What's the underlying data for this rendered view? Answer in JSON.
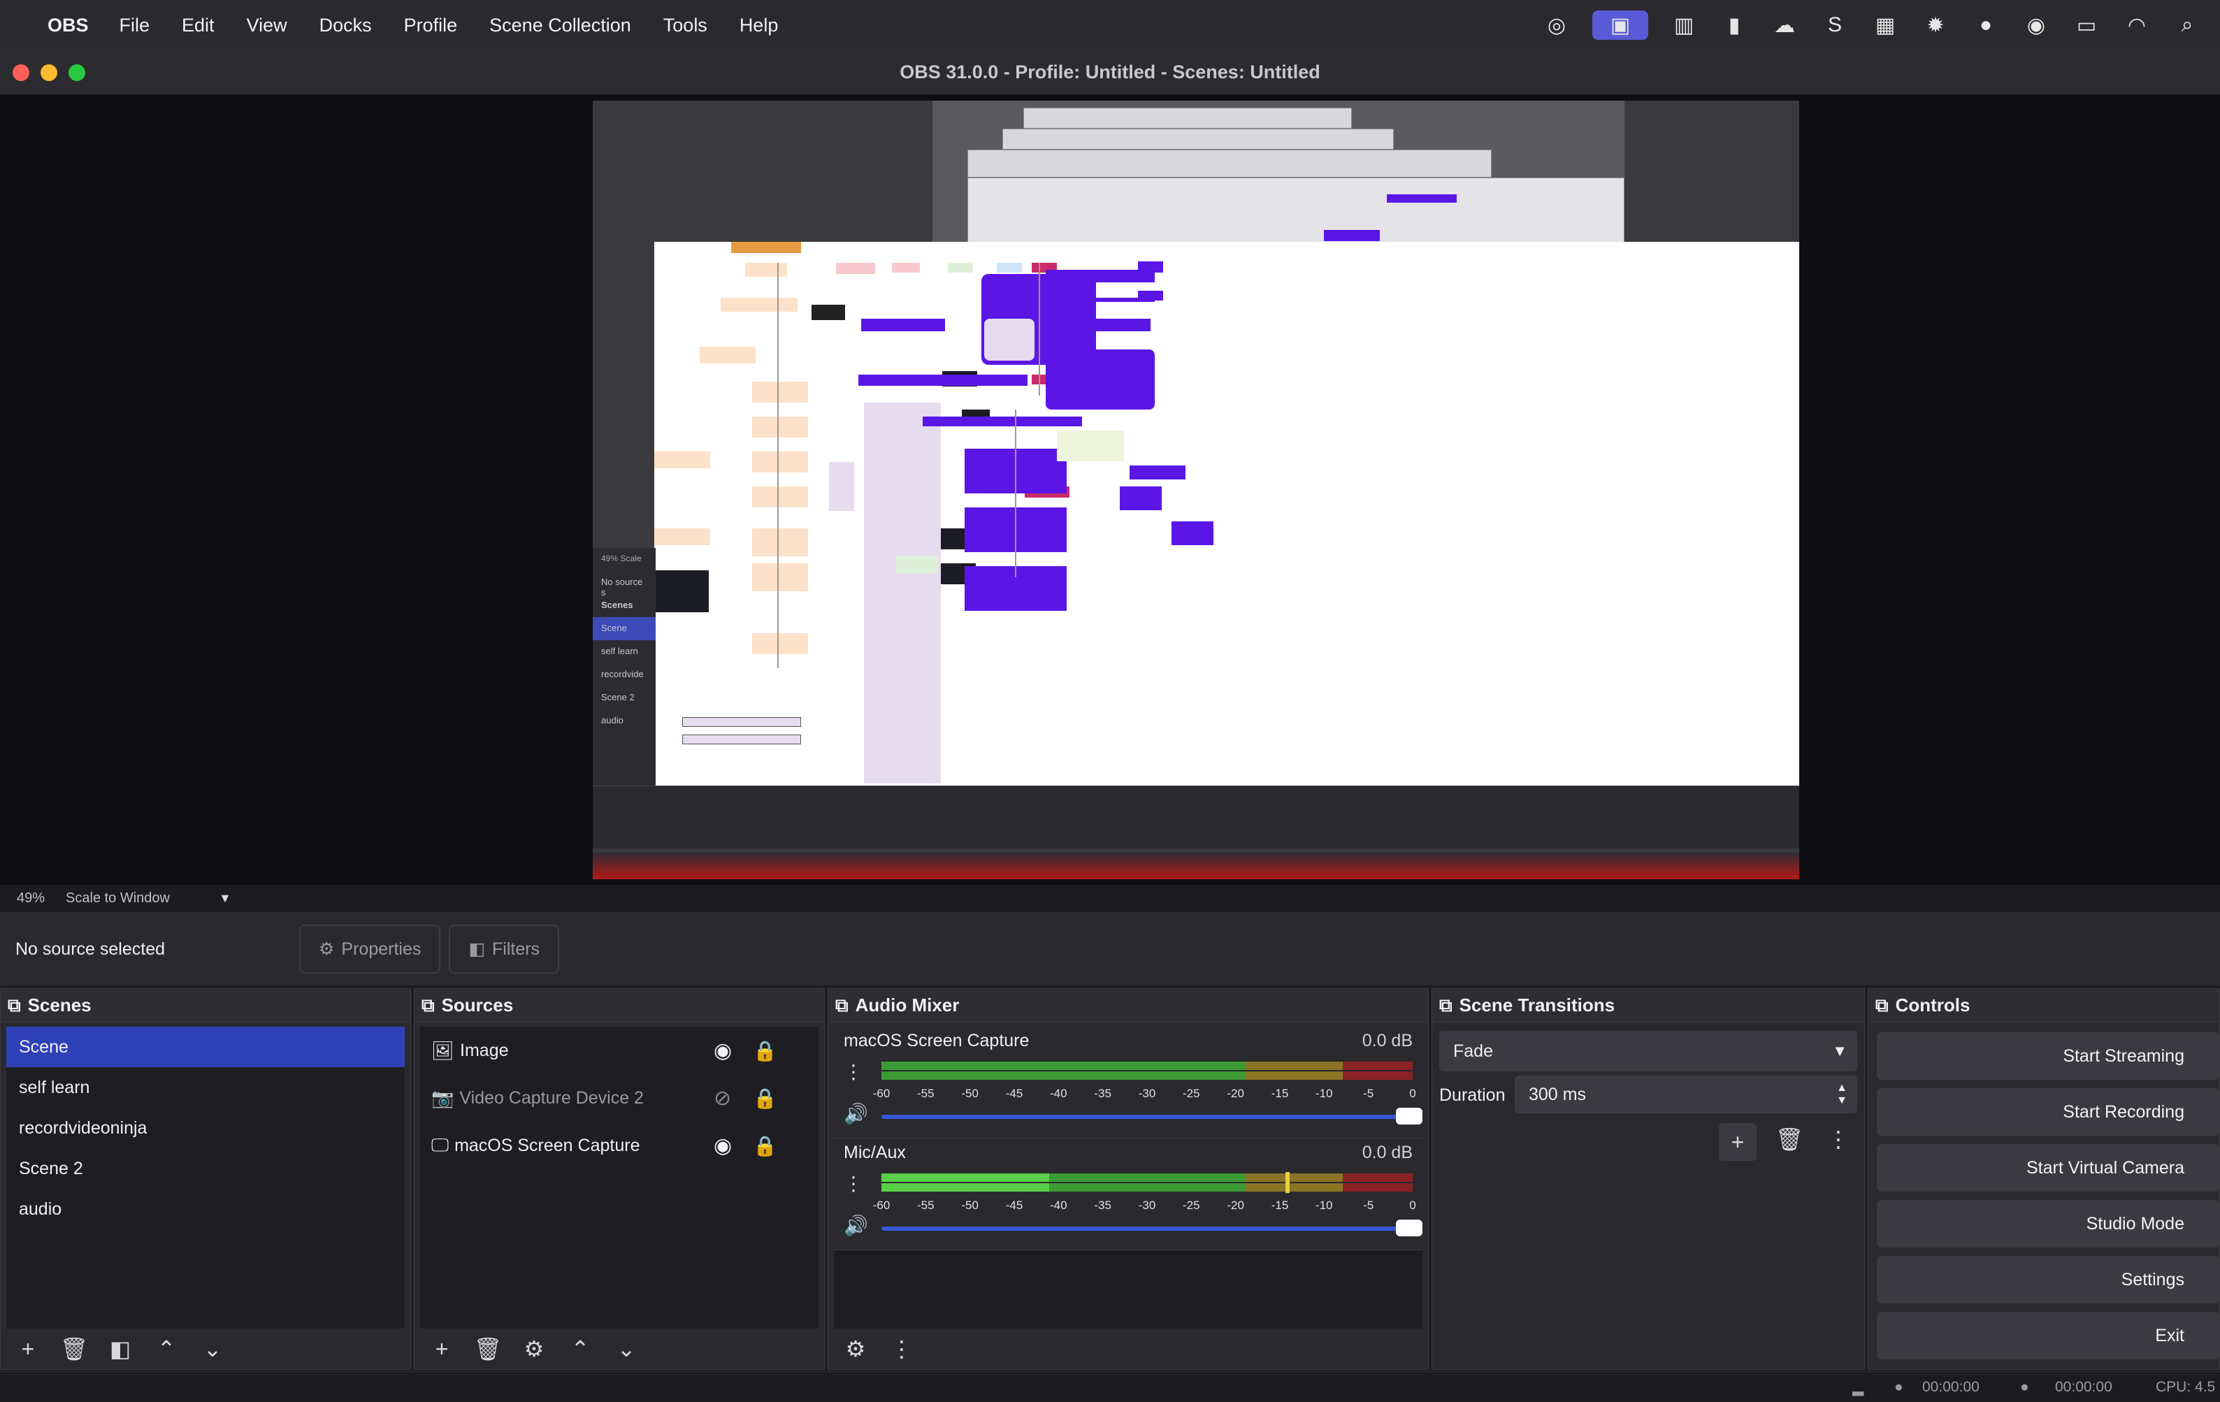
{
  "menubar": {
    "app": "OBS",
    "items": [
      "File",
      "Edit",
      "View",
      "Docks",
      "Profile",
      "Scene Collection",
      "Tools",
      "Help"
    ]
  },
  "window": {
    "title": "OBS 31.0.0 - Profile: Untitled - Scenes: Untitled"
  },
  "preview": {
    "nested_zoom": "49%",
    "nested_scale": "Scale",
    "nested_nosource": "No source s",
    "nested_scenes_title": "Scenes",
    "nested_scenes": [
      "Scene",
      "self learn",
      "recordvide",
      "Scene 2",
      "audio"
    ]
  },
  "zoombar": {
    "zoom": "49%",
    "scale_label": "Scale to Window"
  },
  "context": {
    "no_source": "No source selected",
    "properties": "Properties",
    "filters": "Filters"
  },
  "scenes": {
    "title": "Scenes",
    "items": [
      "Scene",
      "self learn",
      "recordvideoninja",
      "Scene 2",
      "audio"
    ]
  },
  "sources": {
    "title": "Sources",
    "items": [
      {
        "label": "Image",
        "icon": "image-icon",
        "visible": true
      },
      {
        "label": "Video Capture Device 2",
        "icon": "camera-icon",
        "visible": false
      },
      {
        "label": "macOS Screen Capture",
        "icon": "monitor-icon",
        "visible": true
      }
    ]
  },
  "mixer": {
    "title": "Audio Mixer",
    "ticks": [
      "-60",
      "-55",
      "-50",
      "-45",
      "-40",
      "-35",
      "-30",
      "-25",
      "-20",
      "-15",
      "-10",
      "-5",
      "0"
    ],
    "channels": [
      {
        "name": "macOS Screen Capture",
        "db": "0.0 dB",
        "volume_level": 1.0
      },
      {
        "name": "Mic/Aux",
        "db": "0.0 dB",
        "volume_level": 1.0
      }
    ]
  },
  "transitions": {
    "title": "Scene Transitions",
    "selected": "Fade",
    "duration_label": "Duration",
    "duration_value": "300 ms"
  },
  "controls": {
    "title": "Controls",
    "buttons": [
      "Start Streaming",
      "Start Recording",
      "Start Virtual Camera",
      "Studio Mode",
      "Settings",
      "Exit"
    ]
  },
  "status": {
    "stream_time": "00:00:00",
    "record_time": "00:00:00",
    "cpu": "CPU: 4.5"
  },
  "colors": {
    "accent": "#2f41b7",
    "meter_green": "#3c9a34",
    "meter_yellow": "#8a7424",
    "meter_red": "#8a2226",
    "purple": "#5b16e6",
    "pink": "#cc2a6a"
  }
}
